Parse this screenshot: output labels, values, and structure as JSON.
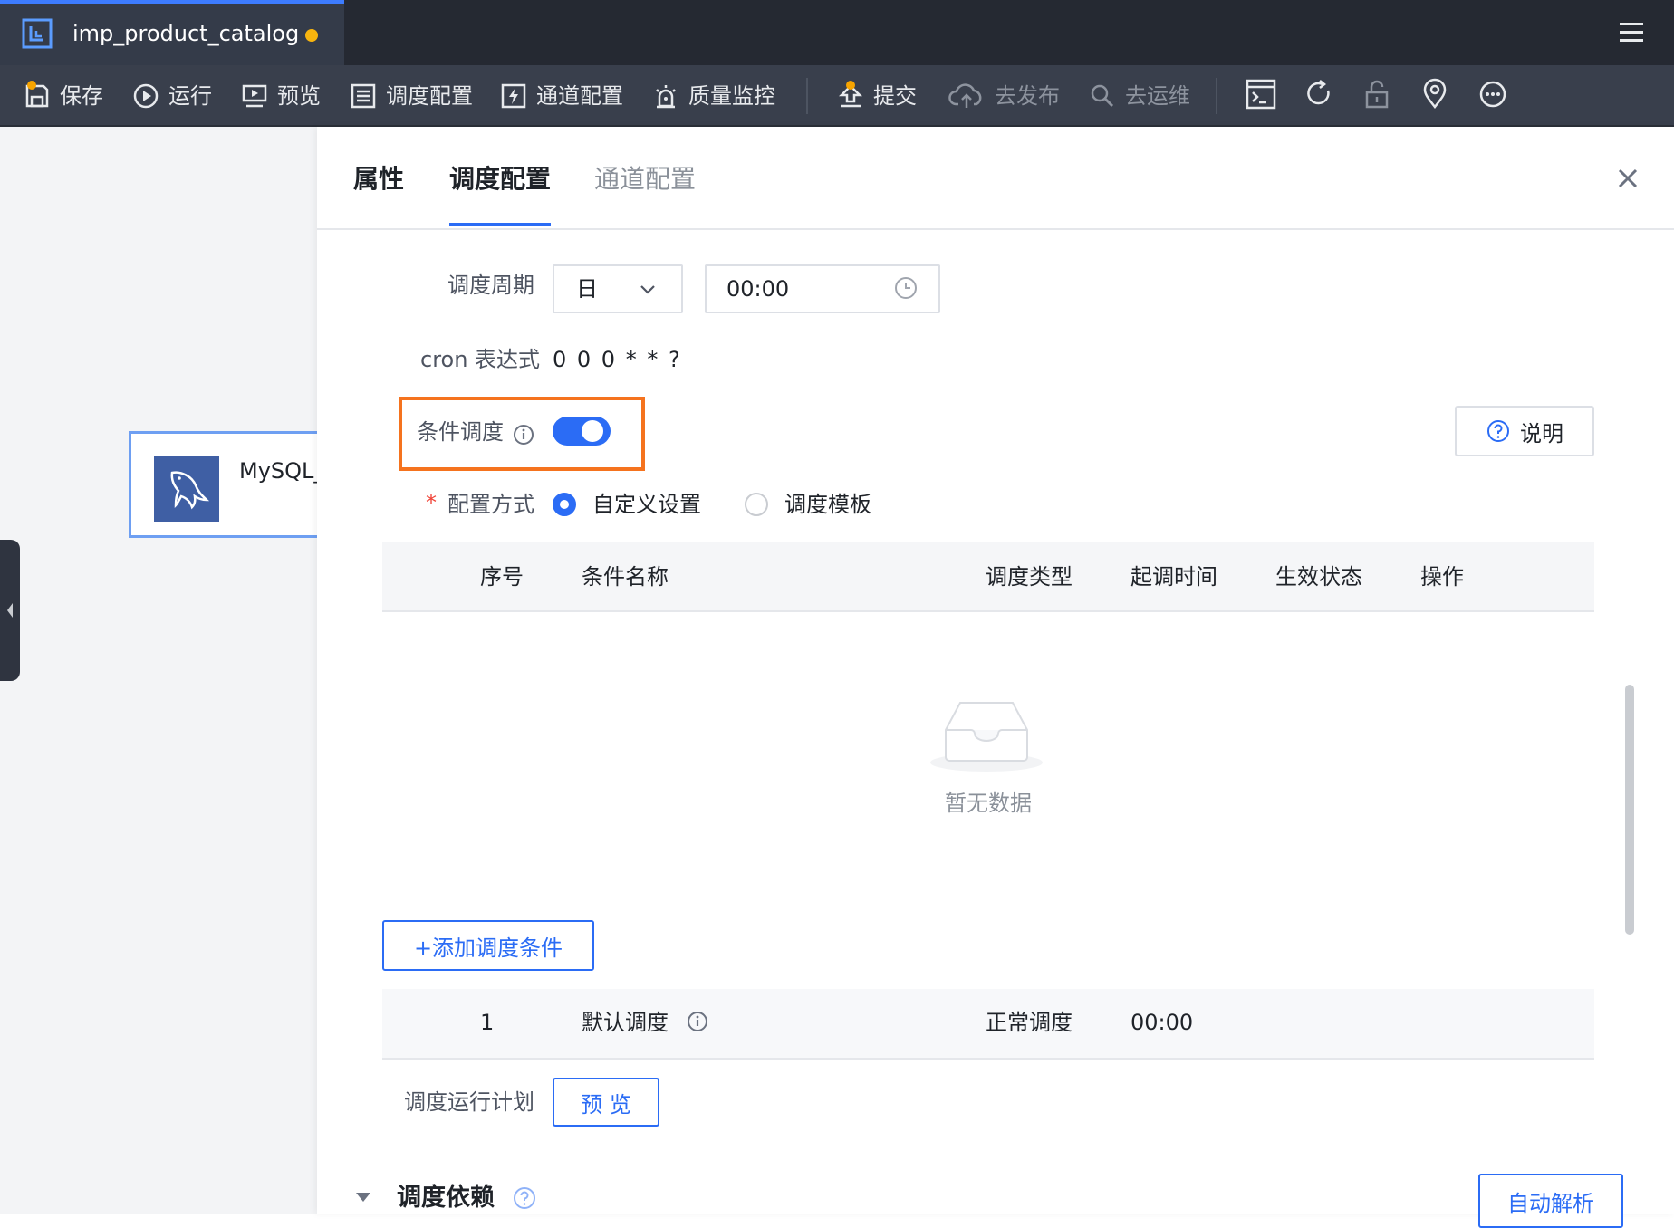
{
  "tab": {
    "file_name": "imp_product_catalog"
  },
  "toolbar": {
    "save": "保存",
    "run": "运行",
    "preview": "预览",
    "schedule_config": "调度配置",
    "channel_config": "通道配置",
    "quality_monitor": "质量监控",
    "submit": "提交",
    "publish": "去发布",
    "ops": "去运维"
  },
  "canvas": {
    "node_label": "MySQL_"
  },
  "drawer": {
    "tabs": {
      "properties": "属性",
      "schedule": "调度配置",
      "channel": "通道配置"
    },
    "schedule_period": {
      "label": "调度周期",
      "unit": "日",
      "time": "00:00"
    },
    "cron": {
      "label": "cron 表达式",
      "value": "0 0 0 * * ?"
    },
    "conditional": {
      "label": "条件调度",
      "enabled": true
    },
    "help_button": "说明",
    "config_mode": {
      "required_mark": "*",
      "label": "配置方式",
      "options": [
        "自定义设置",
        "调度模板"
      ],
      "selected": "自定义设置"
    },
    "table": {
      "columns": [
        "序号",
        "条件名称",
        "调度类型",
        "起调时间",
        "生效状态",
        "操作"
      ],
      "empty_text": "暂无数据"
    },
    "add_condition": "+添加调度条件",
    "default_row": {
      "index": "1",
      "name": "默认调度",
      "type": "正常调度",
      "time": "00:00"
    },
    "run_plan": {
      "label": "调度运行计划",
      "button": "预 览"
    },
    "dependency": {
      "title": "调度依赖",
      "auto_parse": "自动解析"
    }
  },
  "colors": {
    "accent": "#2b6cf5",
    "highlight": "#f5731e",
    "unsaved": "#f7b40f"
  }
}
